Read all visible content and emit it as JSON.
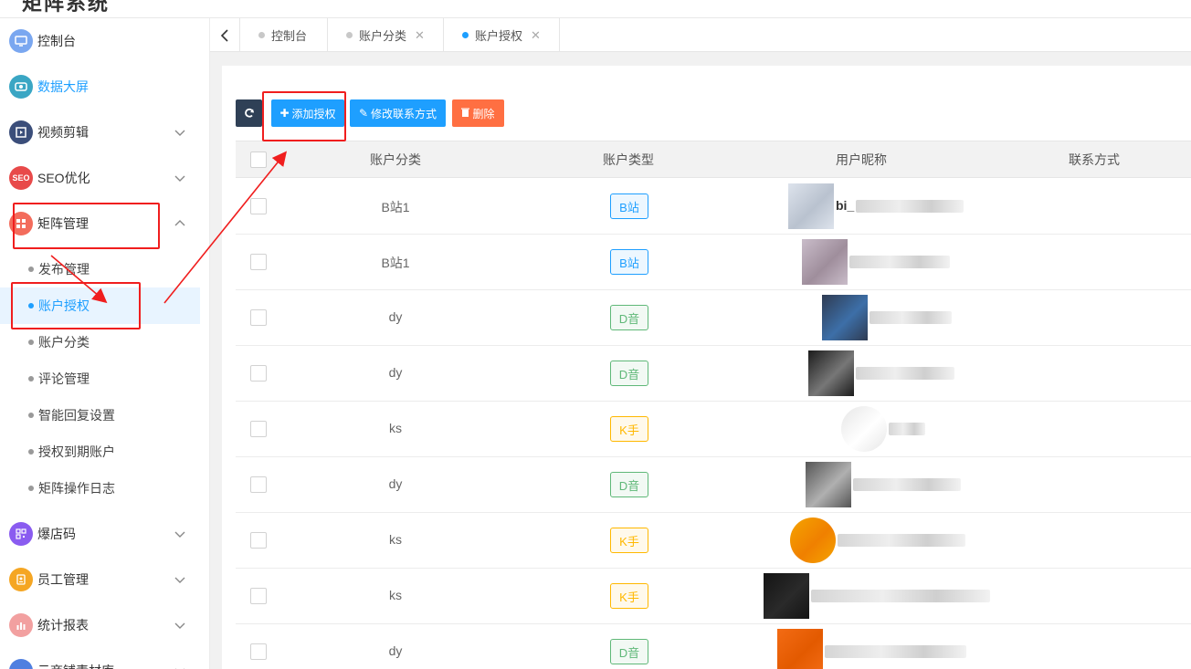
{
  "brand": {
    "title": "矩阵系统"
  },
  "sidebar": {
    "items": [
      {
        "label": "控制台",
        "icon": "monitor-icon",
        "color": "#7aa7f0"
      },
      {
        "label": "数据大屏",
        "icon": "screen-icon",
        "color": "#3aa6c4"
      },
      {
        "label": "视频剪辑",
        "icon": "video-icon",
        "color": "#3b4e7a"
      },
      {
        "label": "SEO优化",
        "icon": "seo-icon",
        "color": "#e84a4a"
      },
      {
        "label": "矩阵管理",
        "icon": "grid-icon",
        "color": "#f36c5c"
      }
    ],
    "sub_items": [
      {
        "label": "发布管理"
      },
      {
        "label": "账户授权"
      },
      {
        "label": "账户分类"
      },
      {
        "label": "评论管理"
      },
      {
        "label": "智能回复设置"
      },
      {
        "label": "授权到期账户"
      },
      {
        "label": "矩阵操作日志"
      }
    ],
    "items_bottom": [
      {
        "label": "爆店码",
        "icon": "qrcode-icon",
        "color": "#8a5cf0"
      },
      {
        "label": "员工管理",
        "icon": "badge-icon",
        "color": "#f5a623"
      },
      {
        "label": "统计报表",
        "icon": "chart-icon",
        "color": "#f2a0a0"
      },
      {
        "label": "云商铺素材库",
        "icon": "store-icon",
        "color": "#4f7fe0"
      }
    ]
  },
  "tabs": [
    {
      "label": "控制台"
    },
    {
      "label": "账户分类"
    },
    {
      "label": "账户授权"
    }
  ],
  "toolbar": {
    "add_label": "添加授权",
    "edit_label": "修改联系方式",
    "delete_label": "删除"
  },
  "table": {
    "headers": [
      "账户分类",
      "账户类型",
      "用户昵称",
      "联系方式"
    ],
    "rows": [
      {
        "category": "B站1",
        "type": "B站",
        "type_color": "#1e9fff",
        "nickname": "bi_"
      },
      {
        "category": "B站1",
        "type": "B站",
        "type_color": "#1e9fff",
        "nickname": ""
      },
      {
        "category": "dy",
        "type": "D音",
        "type_color": "#5fb878",
        "nickname": ""
      },
      {
        "category": "dy",
        "type": "D音",
        "type_color": "#5fb878",
        "nickname": ""
      },
      {
        "category": "ks",
        "type": "K手",
        "type_color": "#ffb800",
        "nickname": ""
      },
      {
        "category": "dy",
        "type": "D音",
        "type_color": "#5fb878",
        "nickname": ""
      },
      {
        "category": "ks",
        "type": "K手",
        "type_color": "#ffb800",
        "nickname": ""
      },
      {
        "category": "ks",
        "type": "K手",
        "type_color": "#ffb800",
        "nickname": ""
      },
      {
        "category": "dy",
        "type": "D音",
        "type_color": "#5fb878",
        "nickname": ""
      }
    ]
  }
}
